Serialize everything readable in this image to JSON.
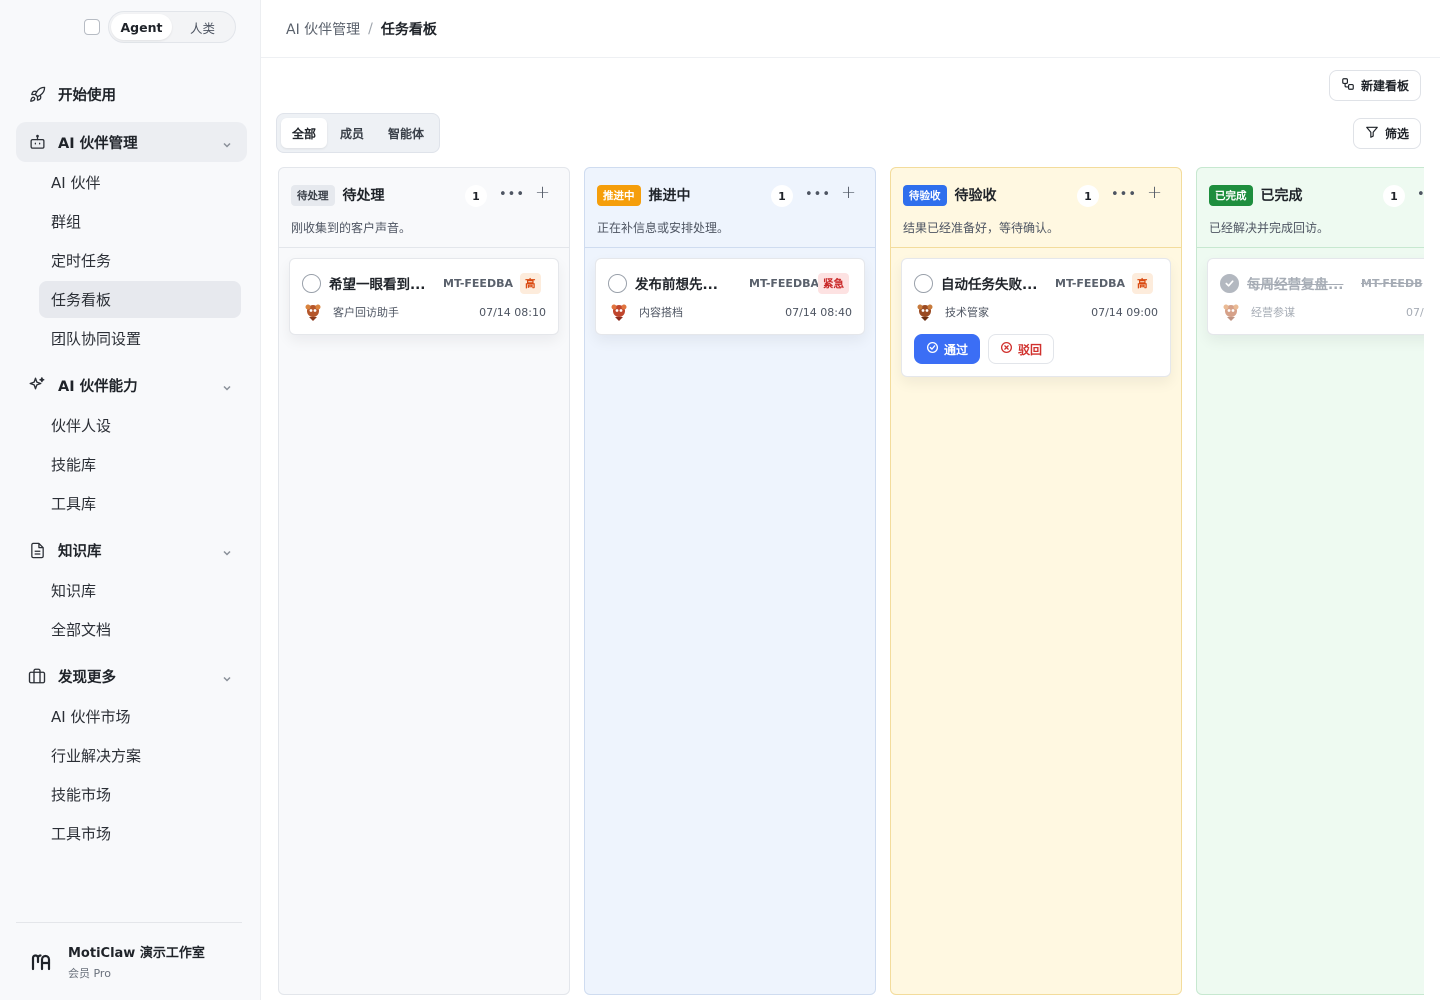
{
  "mode_toggle": {
    "agent": "Agent",
    "human": "人类"
  },
  "nav": {
    "start": {
      "label": "开始使用",
      "icon": "rocket-icon"
    },
    "groups": [
      {
        "label": "AI 伙伴管理",
        "icon": "robot-icon",
        "items": [
          "AI 伙伴",
          "群组",
          "定时任务",
          "任务看板",
          "团队协同设置"
        ]
      },
      {
        "label": "AI 伙伴能力",
        "icon": "sparkle-icon",
        "items": [
          "伙伴人设",
          "技能库",
          "工具库"
        ]
      },
      {
        "label": "知识库",
        "icon": "document-icon",
        "items": [
          "知识库",
          "全部文档"
        ]
      },
      {
        "label": "发现更多",
        "icon": "briefcase-icon",
        "items": [
          "AI 伙伴市场",
          "行业解决方案",
          "技能市场",
          "工具市场"
        ]
      }
    ]
  },
  "org": {
    "name": "MotiClaw 演示工作室",
    "plan": "会员 Pro"
  },
  "breadcrumb": {
    "root": "AI 伙伴管理",
    "sep": "/",
    "current": "任务看板"
  },
  "toolbar": {
    "new_board": "新建看板",
    "filter": "筛选"
  },
  "segments": [
    "全部",
    "成员",
    "智能体"
  ],
  "columns": [
    {
      "badge": "待处理",
      "title": "待处理",
      "count": "1",
      "desc": "刚收集到的客户声音。",
      "colors": {
        "bg": "#f8f9fb",
        "border": "#e3e6eb",
        "badge_bg": "#e6e9ee",
        "badge_fg": "#3a4049"
      },
      "card": {
        "title": "希望一眼看到...",
        "code": "MT-FEEDBA",
        "priority": "高",
        "priority_bg": "#fdecdc",
        "priority_fg": "#d9480f",
        "agent": "客户回访助手",
        "time": "07/14 08:10"
      }
    },
    {
      "badge": "推进中",
      "title": "推进中",
      "count": "1",
      "desc": "正在补信息或安排处理。",
      "colors": {
        "bg": "#eef4fd",
        "border": "#cfdcf0",
        "badge_bg": "#f59e0b",
        "badge_fg": "#ffffff"
      },
      "card": {
        "title": "发布前想先...",
        "code": "MT-FEEDBA",
        "priority": "紧急",
        "priority_bg": "#fde2e2",
        "priority_fg": "#c92a2a",
        "agent": "内容搭档",
        "time": "07/14 08:40"
      }
    },
    {
      "badge": "待验收",
      "title": "待验收",
      "count": "1",
      "desc": "结果已经准备好，等待确认。",
      "colors": {
        "bg": "#fff8e1",
        "border": "#f3dc9c",
        "badge_bg": "#2f6fed",
        "badge_fg": "#ffffff"
      },
      "card": {
        "title": "自动任务失败...",
        "code": "MT-FEEDBA",
        "priority": "高",
        "priority_bg": "#fdecdc",
        "priority_fg": "#d9480f",
        "agent": "技术管家",
        "time": "07/14 09:00",
        "approve": "通过",
        "reject": "驳回"
      }
    },
    {
      "badge": "已完成",
      "title": "已完成",
      "count": "1",
      "desc": "已经解决并完成回访。",
      "colors": {
        "bg": "#eefaf1",
        "border": "#c7e8d0",
        "badge_bg": "#1e8e3e",
        "badge_fg": "#ffffff"
      },
      "card": {
        "title": "每周经营复盘...",
        "code": "MT-FEEDB",
        "agent": "经营参谋",
        "time": "07/"
      }
    }
  ]
}
